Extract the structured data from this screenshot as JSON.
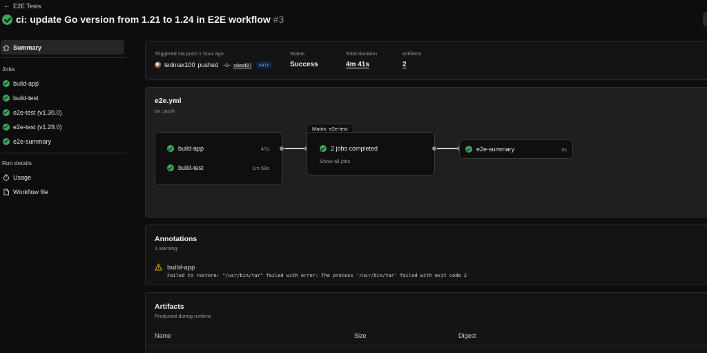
{
  "header": {
    "back_label": "E2E Tests",
    "title": "ci: update Go version from 1.21 to 1.24 in E2E workflow",
    "run_number": "#3"
  },
  "sidebar": {
    "summary_label": "Summary",
    "jobs_heading": "Jobs",
    "jobs": [
      {
        "label": "build-app",
        "icon": "check-circle-icon"
      },
      {
        "label": "build-test",
        "icon": "check-circle-icon"
      },
      {
        "label": "e2e-test (v1.30.0)",
        "icon": "check-circle-icon"
      },
      {
        "label": "e2e-test (v1.29.0)",
        "icon": "check-circle-icon"
      },
      {
        "label": "e2e-summary",
        "icon": "check-circle-icon"
      }
    ],
    "run_details_heading": "Run details",
    "run_details": [
      {
        "label": "Usage",
        "icon": "stopwatch-icon"
      },
      {
        "label": "Workflow file",
        "icon": "file-icon"
      }
    ]
  },
  "status_panel": {
    "trigger_label": "Triggered via push 1 hour ago",
    "actor": "tedmax100",
    "action": "pushed",
    "commit": "c8eaf97",
    "branch": "main",
    "status_label": "Status",
    "status_value": "Success",
    "duration_label": "Total duration",
    "duration_value": "4m 41s",
    "artifacts_label": "Artifacts",
    "artifacts_value": "2"
  },
  "workflow_graph": {
    "file": "e2e.yml",
    "trigger": "on: push",
    "group1": [
      {
        "name": "build-app",
        "time": "47s"
      },
      {
        "name": "build-test",
        "time": "1m 59s"
      }
    ],
    "matrix": {
      "tab_label": "Matrix: e2e-test",
      "summary": "2 jobs completed",
      "link": "Show all jobs"
    },
    "final_job": {
      "name": "e2e-summary",
      "time": "3s"
    }
  },
  "annotations": {
    "title": "Annotations",
    "count": "1 warning",
    "items": [
      {
        "job": "build-app",
        "message": "Failed to restore: \"/usr/bin/tar\" failed with error: The process '/usr/bin/tar' failed with exit code 2",
        "icon": "warning-icon"
      }
    ]
  },
  "artifacts": {
    "title": "Artifacts",
    "subtitle": "Produced during runtime",
    "columns": [
      "Name",
      "Size",
      "Digest"
    ]
  },
  "colors": {
    "success": "#3fa45b",
    "warning": "#d29922",
    "branch": "#6ea8ff"
  }
}
